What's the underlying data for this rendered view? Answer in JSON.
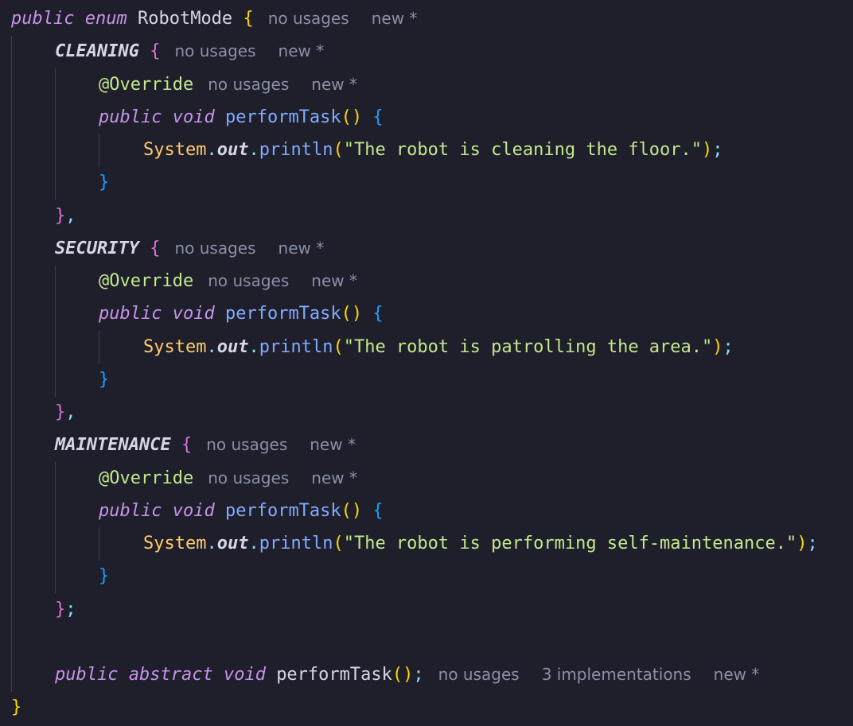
{
  "code": {
    "enum_decl": {
      "public_kw": "public",
      "enum_kw": "enum",
      "name": "RobotMode",
      "open_brace": "{"
    },
    "constants": [
      {
        "name": "CLEANING",
        "message": "\"The robot is cleaning the floor.\""
      },
      {
        "name": "SECURITY",
        "message": "\"The robot is patrolling the area.\""
      },
      {
        "name": "MAINTENANCE",
        "message": "\"The robot is performing self-maintenance.\""
      }
    ],
    "annotation": "@Override",
    "method_public_kw": "public",
    "method_void_kw": "void",
    "method_name": "performTask",
    "system_cls": "System",
    "out_field": "out",
    "println": "println",
    "abstract_line": {
      "public_kw": "public",
      "abstract_kw": "abstract",
      "void_kw": "void",
      "name": "performTask"
    }
  },
  "hints": {
    "no_usages": "no usages",
    "new": "new *",
    "implementations": "3 implementations"
  },
  "colors": {
    "background": "#1e1f2b",
    "keyword": "#c792ea",
    "method": "#82aaff",
    "string": "#c3e88d",
    "hint": "#8a8fa8"
  }
}
